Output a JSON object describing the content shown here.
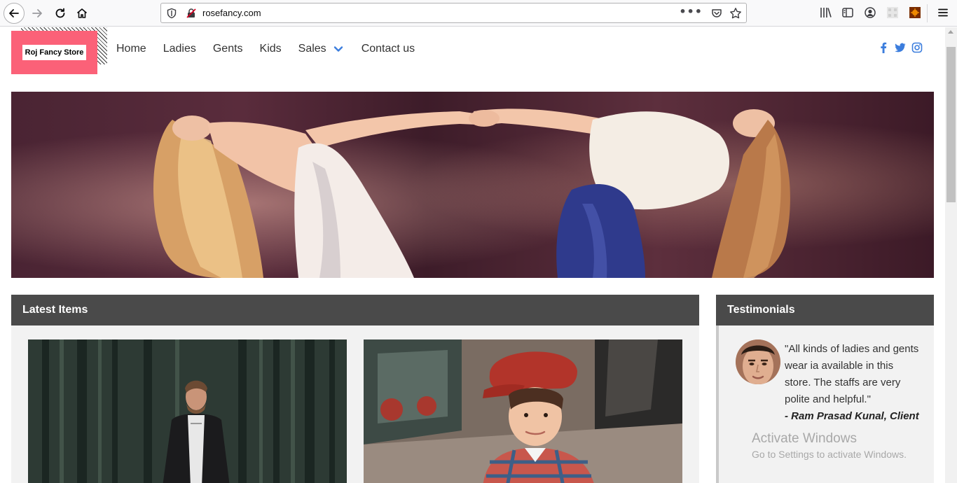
{
  "browser": {
    "url": "rosefancy.com",
    "url_menu_glyph": "•••",
    "icons": [
      "back-icon",
      "forward-icon",
      "reload-icon",
      "home-icon",
      "shield-icon",
      "insecure-lock-icon",
      "pocket-icon",
      "star-icon",
      "library-icon",
      "sidebar-icon",
      "account-icon",
      "extension-icon",
      "menu-icon"
    ]
  },
  "header": {
    "logo_text": "Roj Fancy Store",
    "nav": {
      "home": "Home",
      "ladies": "Ladies",
      "gents": "Gents",
      "kids": "Kids",
      "sales": "Sales",
      "contact": "Contact us"
    },
    "social_icons": [
      "facebook-icon",
      "twitter-icon",
      "instagram-icon"
    ],
    "accent_color": "#fb6178",
    "link_color": "#3b7ddd"
  },
  "sections": {
    "latest_title": "Latest Items",
    "testimonials_title": "Testimonials"
  },
  "testimonial": {
    "quote": "\"All kinds of ladies and gents wear ia available in this store. The staffs are very polite and helpful.\"",
    "author": "- Ram Prasad Kunal, Client"
  },
  "watermark": {
    "title": "Activate Windows",
    "subtitle": "Go to Settings to activate Windows."
  }
}
